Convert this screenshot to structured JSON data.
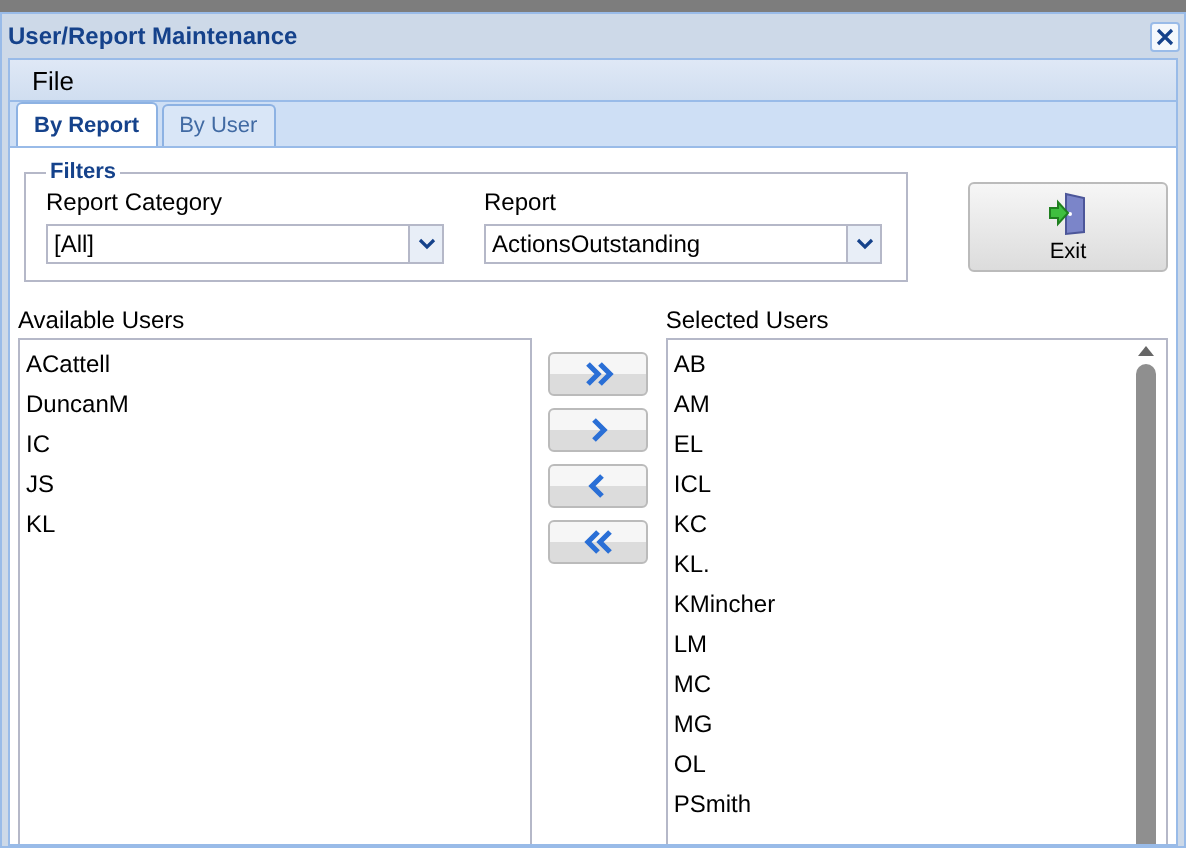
{
  "window": {
    "title": "User/Report Maintenance"
  },
  "menu": [
    "File"
  ],
  "tabs": [
    {
      "label": "By Report",
      "selected": true
    },
    {
      "label": "By User",
      "selected": false
    }
  ],
  "filters": {
    "legend": "Filters",
    "fields": [
      {
        "label": "Report Category",
        "value": "[All]"
      },
      {
        "label": "Report",
        "value": "ActionsOutstanding"
      }
    ]
  },
  "exit_button": "Exit",
  "available_users": {
    "label": "Available Users",
    "items": [
      "ACattell",
      "DuncanM",
      "IC",
      "JS",
      "KL"
    ]
  },
  "move_buttons": [
    {
      "kind": "all-right"
    },
    {
      "kind": "right"
    },
    {
      "kind": "left"
    },
    {
      "kind": "all-left"
    }
  ],
  "selected_users": {
    "label": "Selected Users",
    "items": [
      "AB",
      "AM",
      "EL",
      "ICL",
      "KC",
      "KL.",
      "KMincher",
      "LM",
      "MC",
      "MG",
      "OL",
      "PSmith"
    ]
  }
}
